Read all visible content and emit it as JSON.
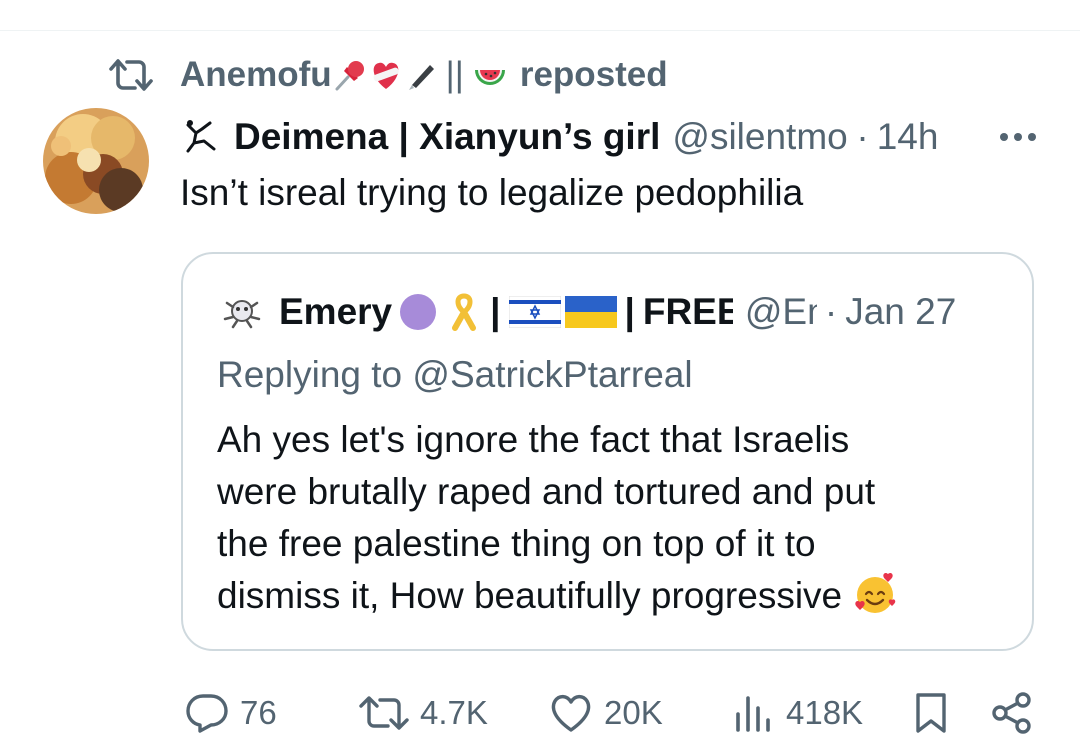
{
  "repost": {
    "icon": "repost-icon",
    "user_name": "Anemofu",
    "separator": "||",
    "label": "reposted"
  },
  "tweet": {
    "display_name": "Deimena | Xianyun’s girl",
    "handle": "@silentmoon",
    "dot": "·",
    "time": "14h",
    "text": "Isn’t isreal trying to legalize pedophilia"
  },
  "quote": {
    "name": "Emery",
    "bar1": "|",
    "bar2": "|",
    "name_suffix": "FREE",
    "handle": "@Emery",
    "dot": "·",
    "time": "Jan 27",
    "replying": "Replying to @SatrickPtarreal",
    "body_lines": [
      "Ah yes let's ignore the fact that Israelis",
      "were brutally raped and tortured and put",
      "the free palestine thing on top of it to",
      "dismiss it, How beautifully progressive"
    ]
  },
  "actions": {
    "replies": "76",
    "reposts": "4.7K",
    "likes": "20K",
    "views": "418K"
  },
  "colors": {
    "secondary_text": "#536471",
    "primary_text": "#0f1419",
    "card_border": "#cfd9de"
  }
}
